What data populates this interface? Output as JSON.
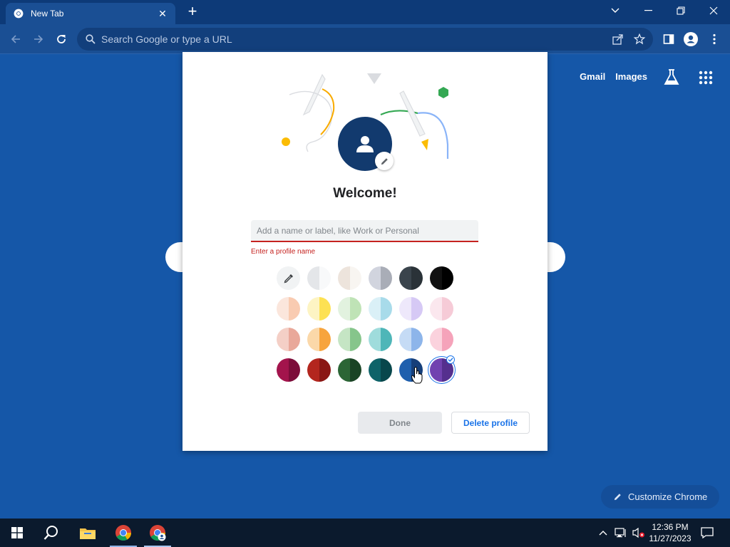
{
  "browser": {
    "tab_title": "New Tab",
    "omnibox_placeholder": "Search Google or type a URL"
  },
  "ntp": {
    "links": [
      "Gmail",
      "Images"
    ],
    "customize_label": "Customize Chrome"
  },
  "dialog": {
    "title": "Welcome!",
    "name_placeholder": "Add a name or label, like Work or Personal",
    "name_value": "",
    "error_text": "Enter a profile name",
    "done_label": "Done",
    "delete_label": "Delete profile",
    "selected_color_index": 22,
    "colors": [
      {
        "l": "#e4e6e9",
        "r": "#f8f9fa"
      },
      {
        "l": "#ede4dc",
        "r": "#f8f5f1"
      },
      {
        "l": "#d1d4de",
        "r": "#a9adb7"
      },
      {
        "l": "#3a444c",
        "r": "#2a3238"
      },
      {
        "l": "#111111",
        "r": "#000000"
      },
      {
        "l": "#fbe6dc",
        "r": "#f9cbb1"
      },
      {
        "l": "#fdf4c3",
        "r": "#fde153"
      },
      {
        "l": "#e2f2df",
        "r": "#bfe3b6"
      },
      {
        "l": "#daf0f7",
        "r": "#a8dbea"
      },
      {
        "l": "#eee8fb",
        "r": "#d6c9f5"
      },
      {
        "l": "#fbe7ee",
        "r": "#f6cbd7"
      },
      {
        "l": "#f4cfc6",
        "r": "#e9a89a"
      },
      {
        "l": "#fbd8a9",
        "r": "#f7a43d"
      },
      {
        "l": "#c5e5c4",
        "r": "#86c58b"
      },
      {
        "l": "#9fdcdc",
        "r": "#4eb6b8"
      },
      {
        "l": "#c5dbf5",
        "r": "#8db5ea"
      },
      {
        "l": "#fbd2dd",
        "r": "#f5a3ba"
      },
      {
        "l": "#a3144c",
        "r": "#7c0d3a"
      },
      {
        "l": "#b3261e",
        "r": "#8a1714"
      },
      {
        "l": "#2b6535",
        "r": "#1a4425"
      },
      {
        "l": "#0e6369",
        "r": "#08474c"
      },
      {
        "l": "#1f5fad",
        "r": "#163f7a"
      },
      {
        "l": "#7142b0",
        "r": "#552f8e"
      }
    ]
  },
  "taskbar": {
    "time": "12:36 PM",
    "date": "11/27/2023"
  }
}
